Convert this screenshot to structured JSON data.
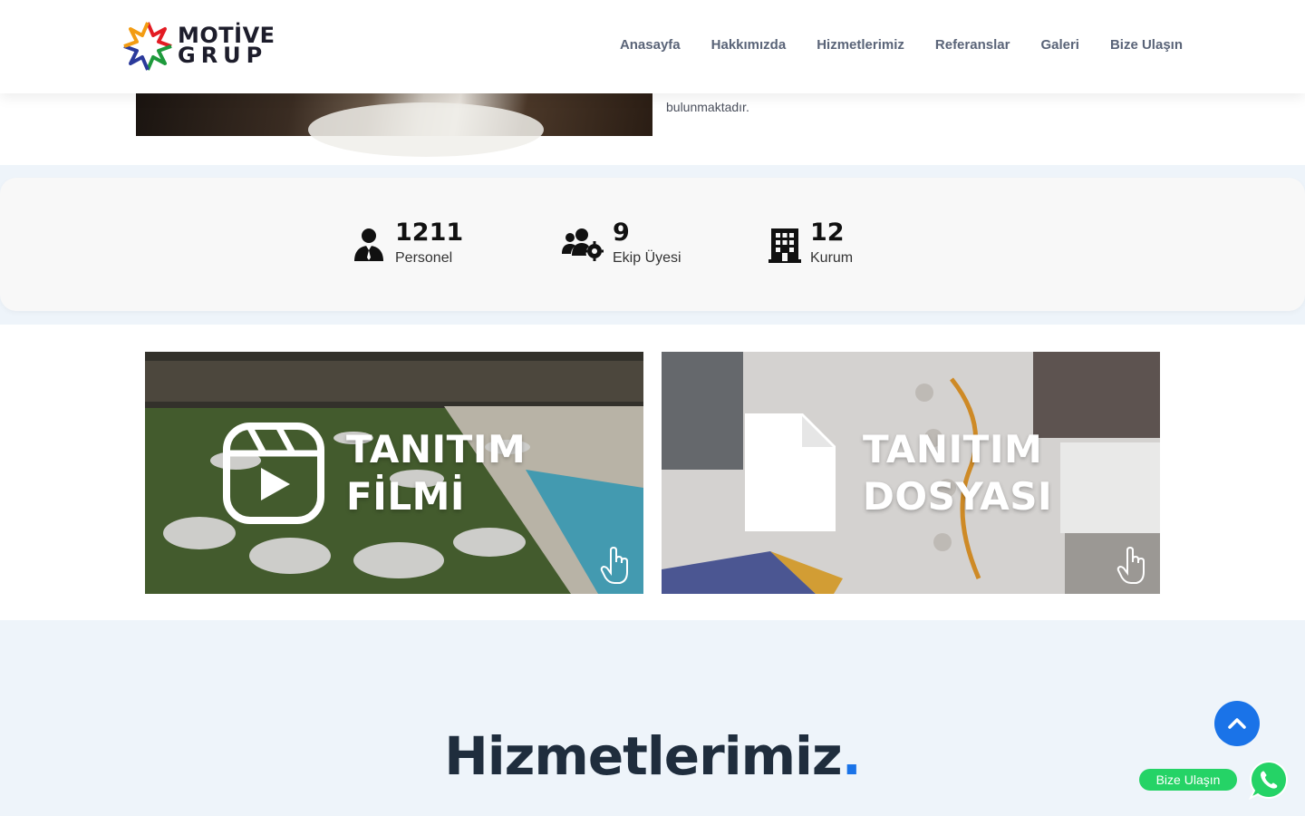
{
  "header": {
    "logo_line1": "MOTİVE",
    "logo_line2": "GRUP",
    "nav": [
      "Anasayfa",
      "Hakkımızda",
      "Hizmetlerimiz",
      "Referanslar",
      "Galeri",
      "Bize Ulaşın"
    ]
  },
  "about": {
    "text_tail": "bulunmaktadır."
  },
  "stats": [
    {
      "value": "1211",
      "label": "Personel",
      "icon": "person-tie-icon"
    },
    {
      "value": "9",
      "label": "Ekip Üyesi",
      "icon": "users-cog-icon"
    },
    {
      "value": "12",
      "label": "Kurum",
      "icon": "building-icon"
    }
  ],
  "promos": {
    "film": {
      "line1": "TANITIM",
      "line2": "FİLMİ",
      "icon": "video-play-icon"
    },
    "doc": {
      "line1": "TANITIM",
      "line2": "DOSYASI",
      "icon": "document-icon"
    }
  },
  "services": {
    "title": "Hizmetlerimiz",
    "dot": "."
  },
  "floating": {
    "whatsapp_label": "Bize Ulaşın"
  },
  "colors": {
    "accent": "#1a73e8",
    "whatsapp": "#25d366",
    "heading": "#1f2d3d"
  }
}
